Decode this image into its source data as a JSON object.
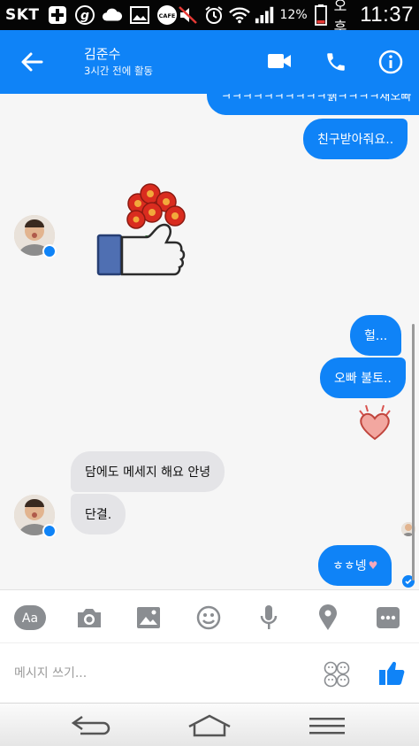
{
  "status_bar": {
    "carrier": "SKT",
    "battery": "12%",
    "ampm": "오후",
    "time": "11:37",
    "icons": [
      "plus-icon",
      "g-icon",
      "cloud-icon",
      "image-icon",
      "cafe-icon",
      "mute-icon",
      "alarm-icon",
      "wifi-icon",
      "signal-icon",
      "battery-icon"
    ]
  },
  "header": {
    "name": "김준수",
    "status": "3시간 전에 활동",
    "color": "#0f83f7"
  },
  "messages": {
    "m1": "ㅋㅋㅋㅋㅋㅋㅋㅋㅋㅋ뷁ㅋㅋㅋㅋ새오빠",
    "m2": "친구받아줘요..",
    "sticker": "flower-thumbs-up-sticker",
    "m3": "헐...",
    "m4": "오빠 불토..",
    "heart": "heart-sticker",
    "m5": "담에도 메세지 해요 안녕",
    "m6": "단결.",
    "m7": "ㅎㅎ넹",
    "m7_emoji": "♥"
  },
  "toolbar": {
    "items": [
      "Aa",
      "camera-icon",
      "gallery-icon",
      "emoji-icon",
      "mic-icon",
      "location-icon",
      "more-icon"
    ]
  },
  "compose": {
    "placeholder": "메시지 쓰기..."
  },
  "colors": {
    "accent": "#0f83f7",
    "incoming": "#e4e4e7",
    "chat_bg": "#f6f6f6"
  }
}
